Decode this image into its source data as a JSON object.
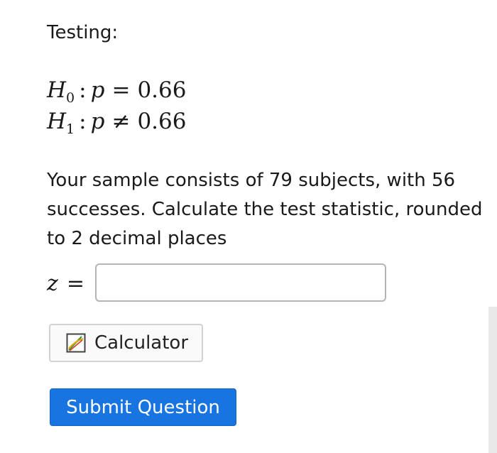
{
  "heading": "Testing:",
  "hypotheses": {
    "null": {
      "symbol": "H",
      "sub": "0",
      "sep": ":",
      "var": "p",
      "op": "=",
      "value": "0.66"
    },
    "alt": {
      "symbol": "H",
      "sub": "1",
      "sep": ":",
      "var": "p",
      "op": "≠",
      "value": "0.66"
    }
  },
  "question": {
    "line1": "Your sample consists of 79 subjects, with 56",
    "line2": "successes. Calculate the test statistic, rounded",
    "line3": "to 2 decimal places"
  },
  "answer": {
    "variable": "z",
    "equals": "=",
    "value": ""
  },
  "buttons": {
    "calculator": "Calculator",
    "submit": "Submit Question"
  },
  "colors": {
    "submit_bg": "#1874e0",
    "input_border": "#b5b5b5"
  },
  "icons": {
    "calculator": "calculator-graph-icon"
  }
}
